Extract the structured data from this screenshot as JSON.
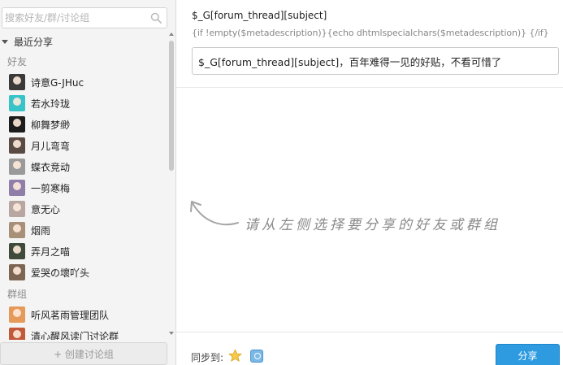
{
  "search": {
    "placeholder": "搜索好友/群/讨论组",
    "icon": "search-icon"
  },
  "recent": {
    "label": "最近分享"
  },
  "friends": {
    "header": "好友",
    "items": [
      {
        "name": "诗意G-JHuc",
        "color": "#3a3a3a"
      },
      {
        "name": "若水玲珑",
        "color": "#37c3c8"
      },
      {
        "name": "柳舞梦缈",
        "color": "#1c1c1c"
      },
      {
        "name": "月儿弯弯",
        "color": "#5a4a44"
      },
      {
        "name": "蝶衣竞动",
        "color": "#9a9a9a"
      },
      {
        "name": "一剪寒梅",
        "color": "#8f7fa8"
      },
      {
        "name": "意无心",
        "color": "#b8a6a2"
      },
      {
        "name": "烟雨",
        "color": "#a88f77"
      },
      {
        "name": "弄月之喵",
        "color": "#3f4a3a"
      },
      {
        "name": "爱哭の壞吖头",
        "color": "#7d6553"
      }
    ]
  },
  "groups": {
    "header": "群组",
    "items": [
      {
        "name": "听风茗雨管理团队",
        "color": "#e69a5a"
      },
      {
        "name": "清心醒风读门讨论群",
        "color": "#c05a3a"
      }
    ]
  },
  "create_button": "+ 创建讨论组",
  "main": {
    "subject_label": "$_G[forum_thread][subject]",
    "description_label": "{if !empty($metadescription)}{echo dhtmlspecialchars($metadescription)} {/if}",
    "message_value": "$_G[forum_thread][subject]，百年难得一见的好贴，不看可惜了",
    "hint": "请从左侧选择要分享的好友或群组"
  },
  "footer": {
    "sync_label": "同步到:",
    "sync_targets": [
      "star-icon",
      "qzone-icon"
    ],
    "share_button": "分享"
  },
  "colors": {
    "accent": "#2e9be0",
    "panel": "#f4f4f4"
  }
}
